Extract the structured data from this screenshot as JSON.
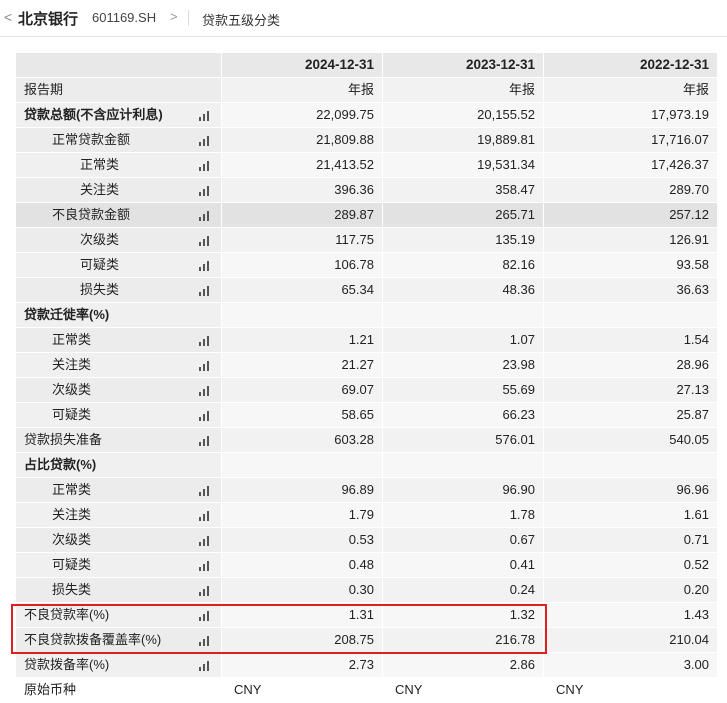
{
  "header": {
    "back_glyph": "<",
    "company": "北京银行",
    "code": "601169.SH",
    "chevron": ">",
    "section": "贷款五级分类"
  },
  "table": {
    "columns": [
      "2024-12-31",
      "2023-12-31",
      "2022-12-31"
    ],
    "rows": [
      {
        "label": "报告期",
        "level": 0,
        "chart": false,
        "values": [
          "年报",
          "年报",
          "年报"
        ]
      },
      {
        "label": "贷款总额(不含应计利息)",
        "level": 0,
        "chart": true,
        "bold": true,
        "values": [
          "22,099.75",
          "20,155.52",
          "17,973.19"
        ]
      },
      {
        "label": "正常贷款金额",
        "level": 1,
        "chart": true,
        "values": [
          "21,809.88",
          "19,889.81",
          "17,716.07"
        ]
      },
      {
        "label": "正常类",
        "level": 2,
        "chart": true,
        "values": [
          "21,413.52",
          "19,531.34",
          "17,426.37"
        ]
      },
      {
        "label": "关注类",
        "level": 2,
        "chart": true,
        "values": [
          "396.36",
          "358.47",
          "289.70"
        ]
      },
      {
        "label": "不良贷款金额",
        "level": 1,
        "chart": true,
        "highlight": true,
        "values": [
          "289.87",
          "265.71",
          "257.12"
        ]
      },
      {
        "label": "次级类",
        "level": 2,
        "chart": true,
        "values": [
          "117.75",
          "135.19",
          "126.91"
        ]
      },
      {
        "label": "可疑类",
        "level": 2,
        "chart": true,
        "values": [
          "106.78",
          "82.16",
          "93.58"
        ]
      },
      {
        "label": "损失类",
        "level": 2,
        "chart": true,
        "values": [
          "65.34",
          "48.36",
          "36.63"
        ]
      },
      {
        "label": "贷款迁徙率(%)",
        "level": 0,
        "chart": false,
        "bold": true,
        "values": [
          "",
          "",
          ""
        ]
      },
      {
        "label": "正常类",
        "level": 1,
        "chart": true,
        "values": [
          "1.21",
          "1.07",
          "1.54"
        ]
      },
      {
        "label": "关注类",
        "level": 1,
        "chart": true,
        "values": [
          "21.27",
          "23.98",
          "28.96"
        ]
      },
      {
        "label": "次级类",
        "level": 1,
        "chart": true,
        "values": [
          "69.07",
          "55.69",
          "27.13"
        ]
      },
      {
        "label": "可疑类",
        "level": 1,
        "chart": true,
        "values": [
          "58.65",
          "66.23",
          "25.87"
        ]
      },
      {
        "label": "贷款损失准备",
        "level": 0,
        "chart": true,
        "values": [
          "603.28",
          "576.01",
          "540.05"
        ]
      },
      {
        "label": "占比贷款(%)",
        "level": 0,
        "chart": false,
        "bold": true,
        "values": [
          "",
          "",
          ""
        ]
      },
      {
        "label": "正常类",
        "level": 1,
        "chart": true,
        "values": [
          "96.89",
          "96.90",
          "96.96"
        ]
      },
      {
        "label": "关注类",
        "level": 1,
        "chart": true,
        "values": [
          "1.79",
          "1.78",
          "1.61"
        ]
      },
      {
        "label": "次级类",
        "level": 1,
        "chart": true,
        "values": [
          "0.53",
          "0.67",
          "0.71"
        ]
      },
      {
        "label": "可疑类",
        "level": 1,
        "chart": true,
        "values": [
          "0.48",
          "0.41",
          "0.52"
        ]
      },
      {
        "label": "损失类",
        "level": 1,
        "chart": true,
        "values": [
          "0.30",
          "0.24",
          "0.20"
        ]
      },
      {
        "label": "不良贷款率(%)",
        "level": 0,
        "chart": true,
        "values": [
          "1.31",
          "1.32",
          "1.43"
        ]
      },
      {
        "label": "不良贷款拨备覆盖率(%)",
        "level": 0,
        "chart": true,
        "values": [
          "208.75",
          "216.78",
          "210.04"
        ]
      },
      {
        "label": "贷款拨备率(%)",
        "level": 0,
        "chart": true,
        "values": [
          "2.73",
          "2.86",
          "3.00"
        ]
      },
      {
        "label": "原始币种",
        "level": 0,
        "chart": false,
        "last": true,
        "values": [
          "CNY",
          "CNY",
          "CNY"
        ]
      }
    ]
  },
  "colors": {
    "highlight_box": "#e02020"
  }
}
